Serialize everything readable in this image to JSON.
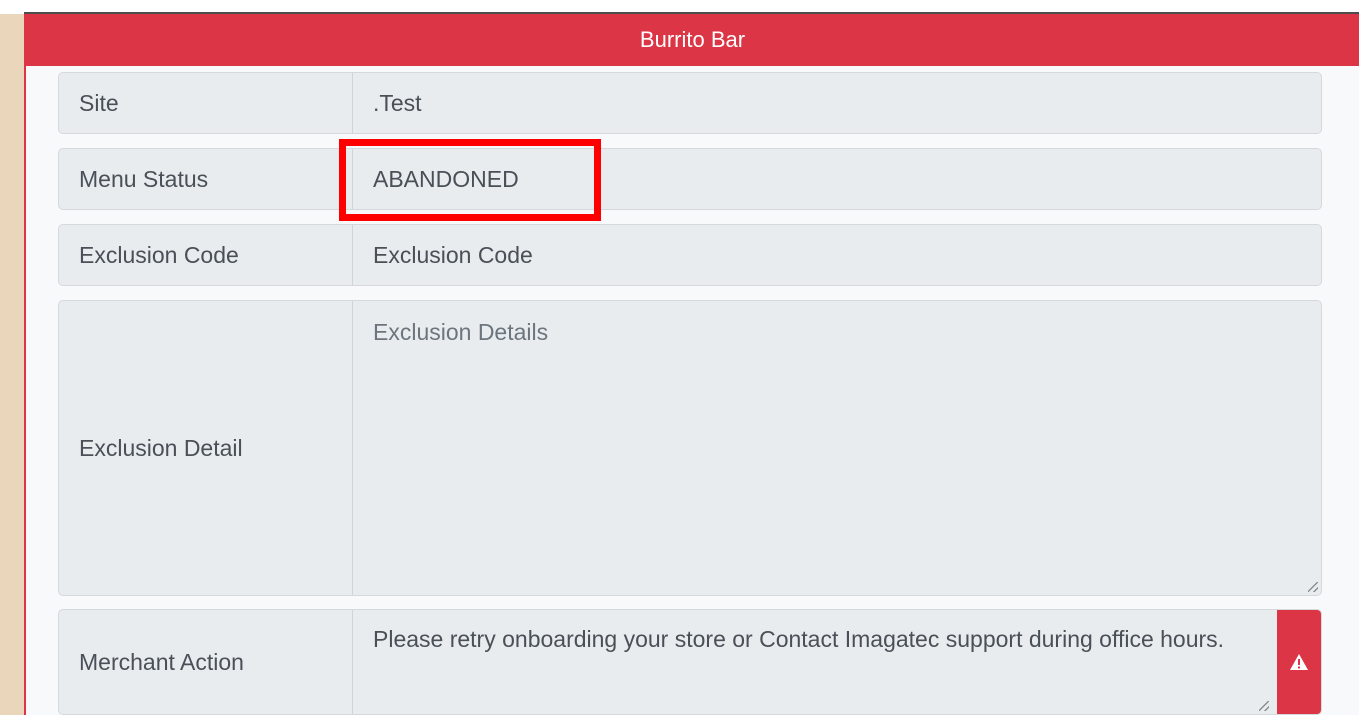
{
  "panel": {
    "title": "Burrito Bar"
  },
  "fields": {
    "site": {
      "label": "Site",
      "value": ".Test"
    },
    "menu_status": {
      "label": "Menu Status",
      "value": "ABANDONED"
    },
    "exclusion_code": {
      "label": "Exclusion Code",
      "placeholder": "Exclusion Code"
    },
    "exclusion_detail": {
      "label": "Exclusion Detail",
      "placeholder": "Exclusion Details"
    },
    "merchant_action": {
      "label": "Merchant Action",
      "value": "Please retry onboarding your store or Contact Imagatec support during office hours."
    }
  },
  "icons": {
    "alert": "warning-icon"
  },
  "colors": {
    "accent": "#dc3545",
    "highlight": "#ff0000",
    "field_bg": "#e9ecef",
    "panel_bg": "#f8f9fa"
  }
}
